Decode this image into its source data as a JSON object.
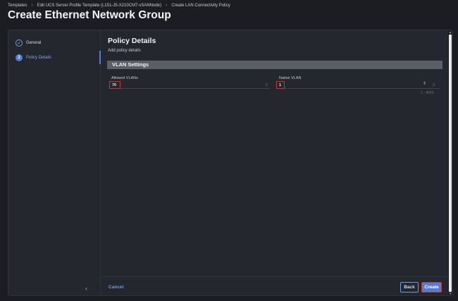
{
  "breadcrumb": [
    "Templates",
    "Edit UCS Server Profile Template (L151-J5-X210CM7-vSANNode)",
    "Create LAN Connectivity Policy"
  ],
  "page_title": "Create Ethernet Network Group",
  "sidebar": {
    "steps": [
      {
        "label": "General",
        "state": "done",
        "marker": "✓"
      },
      {
        "label": "Policy Details",
        "state": "active",
        "marker": "2"
      }
    ],
    "collapse_icon": "chevron-left-icon"
  },
  "main": {
    "title": "Policy Details",
    "subtitle": "Add policy details",
    "vlan_section": {
      "heading": "VLAN Settings",
      "allowed_vlans": {
        "label": "Allowed VLANs",
        "value": "70",
        "hint": "0"
      },
      "native_vlan": {
        "label": "Native VLAN",
        "value": "1",
        "range": "1 - 4093",
        "hint": "0"
      }
    }
  },
  "footer": {
    "cancel_label": "Cancel",
    "back_label": "Back",
    "create_label": "Create"
  },
  "colors": {
    "accent": "#4d7fd6",
    "highlight_border": "#d0312d",
    "background": "#1b1d22",
    "panel": "#24272d",
    "section_bar": "#5a5e66"
  }
}
